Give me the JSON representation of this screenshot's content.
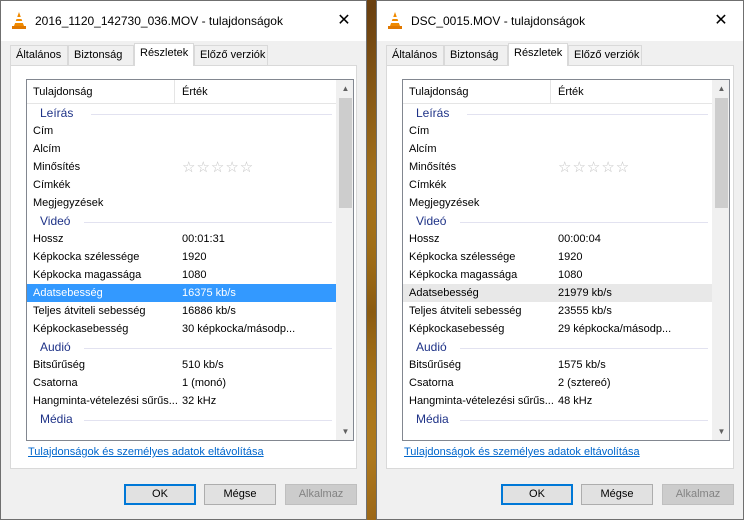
{
  "colors": {
    "accent": "#3399ff",
    "group": "#1e3287",
    "link": "#0066cc"
  },
  "windows": [
    {
      "title": "2016_1120_142730_036.MOV - tulajdonságok",
      "tabs": [
        "Általános",
        "Biztonság",
        "Részletek",
        "Előző verziók"
      ],
      "active_tab": "Részletek",
      "header": {
        "prop": "Tulajdonság",
        "val": "Érték"
      },
      "rows": [
        {
          "type": "group",
          "k": "Leírás"
        },
        {
          "k": "Cím",
          "v": ""
        },
        {
          "k": "Alcím",
          "v": ""
        },
        {
          "k": "Minősítés",
          "v": "☆☆☆☆☆",
          "stars": true
        },
        {
          "k": "Címkék",
          "v": ""
        },
        {
          "k": "Megjegyzések",
          "v": ""
        },
        {
          "type": "group",
          "k": "Videó"
        },
        {
          "k": "Hossz",
          "v": "00:01:31"
        },
        {
          "k": "Képkocka szélessége",
          "v": "1920"
        },
        {
          "k": "Képkocka magassága",
          "v": "1080"
        },
        {
          "k": "Adatsebesség",
          "v": "16375 kb/s",
          "state": "sel"
        },
        {
          "k": "Teljes átviteli sebesség",
          "v": "16886 kb/s"
        },
        {
          "k": "Képkockasebesség",
          "v": "30 képkocka/másodp..."
        },
        {
          "type": "group",
          "k": "Audió"
        },
        {
          "k": "Bitsűrűség",
          "v": "510 kb/s"
        },
        {
          "k": "Csatorna",
          "v": "1 (monó)"
        },
        {
          "k": "Hangminta-vételezési sűrűs...",
          "v": "32 kHz"
        },
        {
          "type": "group",
          "k": "Média"
        }
      ],
      "link": "Tulajdonságok és személyes adatok eltávolítása",
      "buttons": {
        "ok": "OK",
        "cancel": "Mégse",
        "apply": "Alkalmaz"
      }
    },
    {
      "title": "DSC_0015.MOV - tulajdonságok",
      "tabs": [
        "Általános",
        "Biztonság",
        "Részletek",
        "Előző verziók"
      ],
      "active_tab": "Részletek",
      "header": {
        "prop": "Tulajdonság",
        "val": "Érték"
      },
      "rows": [
        {
          "type": "group",
          "k": "Leírás"
        },
        {
          "k": "Cím",
          "v": ""
        },
        {
          "k": "Alcím",
          "v": ""
        },
        {
          "k": "Minősítés",
          "v": "☆☆☆☆☆",
          "stars": true
        },
        {
          "k": "Címkék",
          "v": ""
        },
        {
          "k": "Megjegyzések",
          "v": ""
        },
        {
          "type": "group",
          "k": "Videó"
        },
        {
          "k": "Hossz",
          "v": "00:00:04"
        },
        {
          "k": "Képkocka szélessége",
          "v": "1920"
        },
        {
          "k": "Képkocka magassága",
          "v": "1080"
        },
        {
          "k": "Adatsebesség",
          "v": "21979 kb/s",
          "state": "hl"
        },
        {
          "k": "Teljes átviteli sebesség",
          "v": "23555 kb/s"
        },
        {
          "k": "Képkockasebesség",
          "v": "29 képkocka/másodp..."
        },
        {
          "type": "group",
          "k": "Audió"
        },
        {
          "k": "Bitsűrűség",
          "v": "1575 kb/s"
        },
        {
          "k": "Csatorna",
          "v": "2 (sztereó)"
        },
        {
          "k": "Hangminta-vételezési sűrűs...",
          "v": "48 kHz"
        },
        {
          "type": "group",
          "k": "Média"
        }
      ],
      "link": "Tulajdonságok és személyes adatok eltávolítása",
      "buttons": {
        "ok": "OK",
        "cancel": "Mégse",
        "apply": "Alkalmaz"
      }
    }
  ]
}
